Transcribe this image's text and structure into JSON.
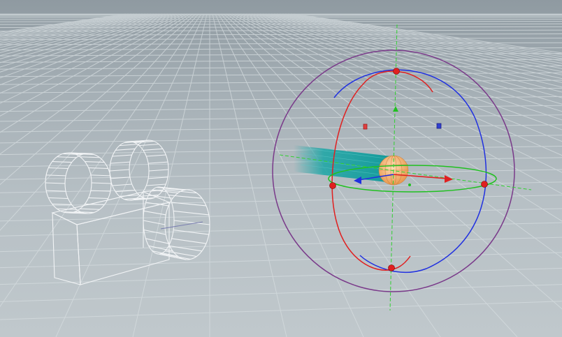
{
  "viewport": {
    "background_top": "#8f9aa1",
    "background_bottom": "#c0c8cc",
    "grid_color": "#d6dde0"
  },
  "objects": {
    "camera": {
      "name": "camera",
      "icon": "camera-icon",
      "wire_color": "#f2f4f6"
    },
    "light": {
      "name": "light",
      "icon": "light-icon",
      "color": "#f0a860",
      "beam_color": "#1aa5a5"
    }
  },
  "handle": {
    "name": "transform-handle",
    "x_color": "#e02020",
    "y_color": "#20c020",
    "z_color": "#2030e0",
    "outer_ring_color": "#7a3a8a"
  }
}
